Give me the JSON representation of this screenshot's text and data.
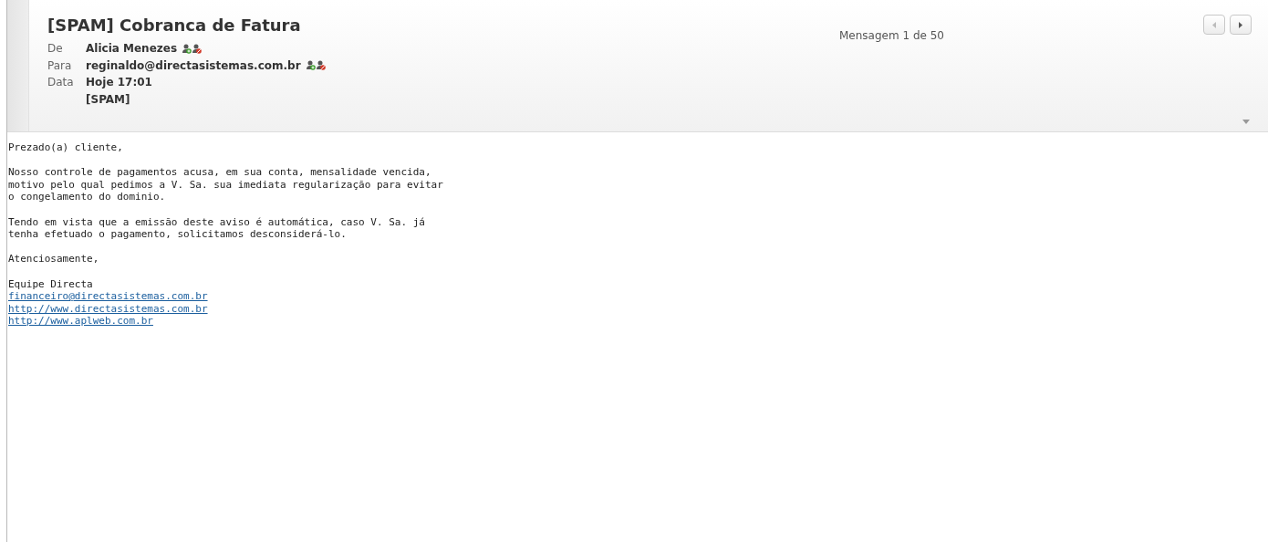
{
  "header": {
    "subject": "[SPAM] Cobranca de Fatura",
    "counter": "Mensagem 1 de 50",
    "fields": [
      {
        "label": "De",
        "value": "Alicia Menezes",
        "contact_icons": true
      },
      {
        "label": "Para",
        "value": "reginaldo@directasistemas.com.br",
        "contact_icons": true
      },
      {
        "label": "Data",
        "value": "Hoje 17:01",
        "contact_icons": false
      },
      {
        "value": "[SPAM]",
        "contact_icons": false
      }
    ],
    "nav": [
      {
        "kind": "prev",
        "disabled": true
      },
      {
        "kind": "next",
        "disabled": false
      }
    ]
  },
  "body": [
    {
      "items": [
        {
          "kind": "text",
          "text": "Prezado(a) cliente,"
        }
      ]
    },
    {
      "items": [
        {
          "kind": "text",
          "text": "Nosso controle de pagamentos acusa, em sua conta, mensalidade vencida,\nmotivo pelo qual pedimos a V. Sa. sua imediata regularização para evitar\no congelamento do dominio."
        }
      ]
    },
    {
      "items": [
        {
          "kind": "text",
          "text": "Tendo em vista que a emissão deste aviso é automática, caso V. Sa. já\ntenha efetuado o pagamento, solicitamos desconsiderá-lo."
        }
      ]
    },
    {
      "items": [
        {
          "kind": "text",
          "text": "Atenciosamente,"
        }
      ]
    },
    {
      "items": [
        {
          "kind": "text",
          "text": "Equipe Directa"
        },
        {
          "kind": "link",
          "text": "financeiro@directasistemas.com.br"
        },
        {
          "kind": "link",
          "text": "http://www.directasistemas.com.br"
        },
        {
          "kind": "link",
          "text": "http://www.aplweb.com.br"
        }
      ]
    }
  ]
}
